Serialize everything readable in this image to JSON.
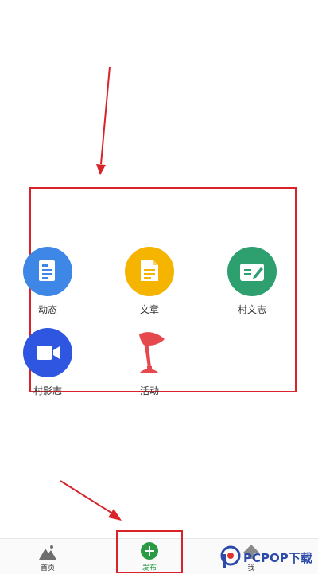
{
  "publish_menu": {
    "items": [
      {
        "label": "动态",
        "icon": "doc-list-icon",
        "color": "#3f87e6"
      },
      {
        "label": "文章",
        "icon": "document-icon",
        "color": "#f5b400"
      },
      {
        "label": "村文志",
        "icon": "edit-note-icon",
        "color": "#2ea070"
      },
      {
        "label": "村影志",
        "icon": "video-camera-icon",
        "color": "#2f56e0"
      },
      {
        "label": "活动",
        "icon": "flag-icon",
        "color": "#e5484d"
      }
    ]
  },
  "bottom_nav": {
    "home_label": "首页",
    "publish_label": "发布",
    "me_label": "我"
  },
  "watermark": {
    "text": "PCPOP下载"
  },
  "annotation_color": "#d9232a"
}
